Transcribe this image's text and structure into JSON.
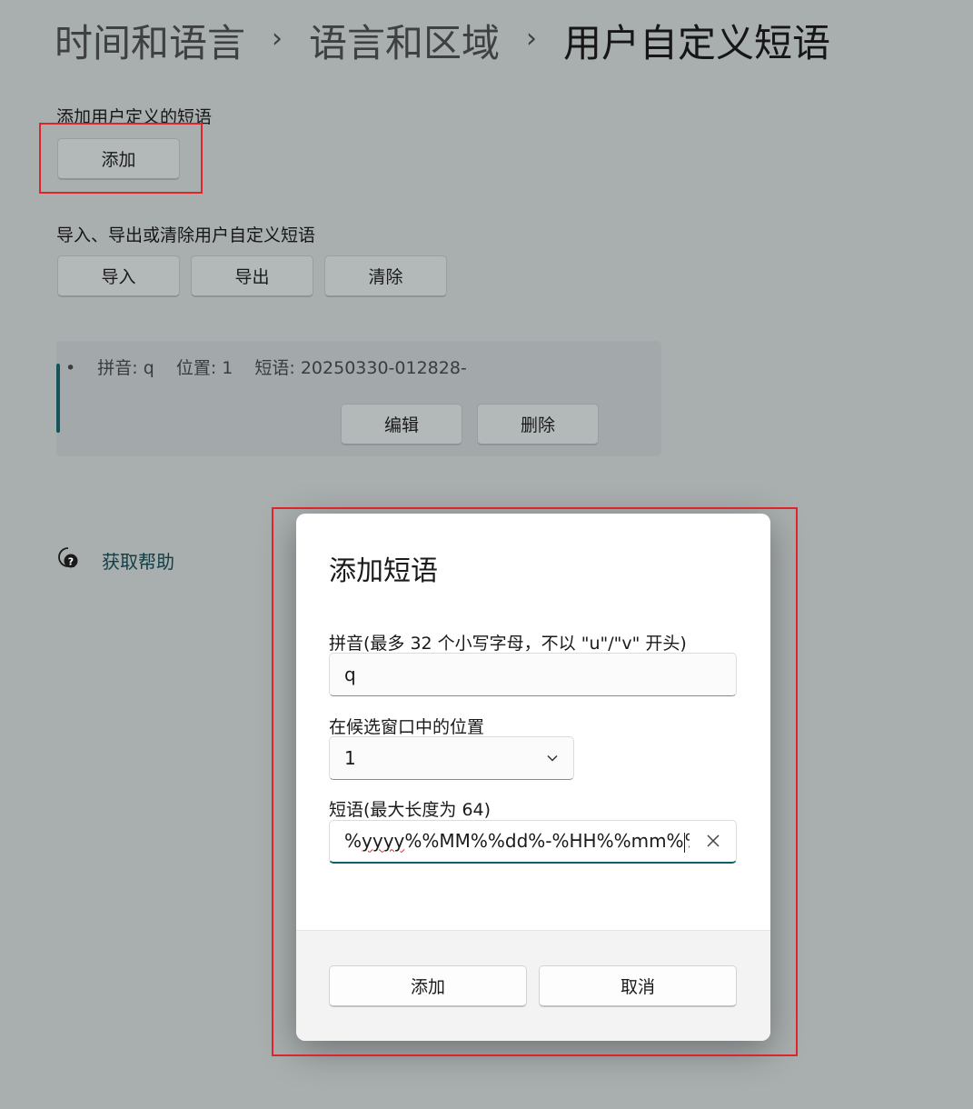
{
  "breadcrumb": {
    "items": [
      "时间和语言",
      "语言和区域",
      "用户自定义短语"
    ],
    "separator": "›"
  },
  "add_section": {
    "label": "添加用户定义的短语",
    "add_button": "添加"
  },
  "manage_section": {
    "label": "导入、导出或清除用户自定义短语",
    "import_button": "导入",
    "export_button": "导出",
    "clear_button": "清除"
  },
  "entry": {
    "bullet": "•",
    "pinyin": "拼音: q",
    "position": "位置: 1",
    "phrase": "短语: 20250330-012828-",
    "edit_button": "编辑",
    "delete_button": "删除"
  },
  "help": {
    "icon": "help-chat-icon",
    "label": "获取帮助"
  },
  "dialog": {
    "title": "添加短语",
    "pinyin_label": "拼音(最多 32 个小写字母，不以 \"u\"/\"v\" 开头)",
    "pinyin_value": "q",
    "position_label": "在候选窗口中的位置",
    "position_value": "1",
    "phrase_label": "短语(最大长度为 64)",
    "phrase_prefix": "%",
    "phrase_misspelled": "yyyy",
    "phrase_before_caret": "%%MM%%dd%-%HH%%mm%",
    "phrase_after_caret": "%s",
    "add_button": "添加",
    "cancel_button": "取消"
  },
  "colors": {
    "background": "#a9aeaf",
    "highlight": "#e0242c",
    "accent": "#0f5f6a"
  }
}
